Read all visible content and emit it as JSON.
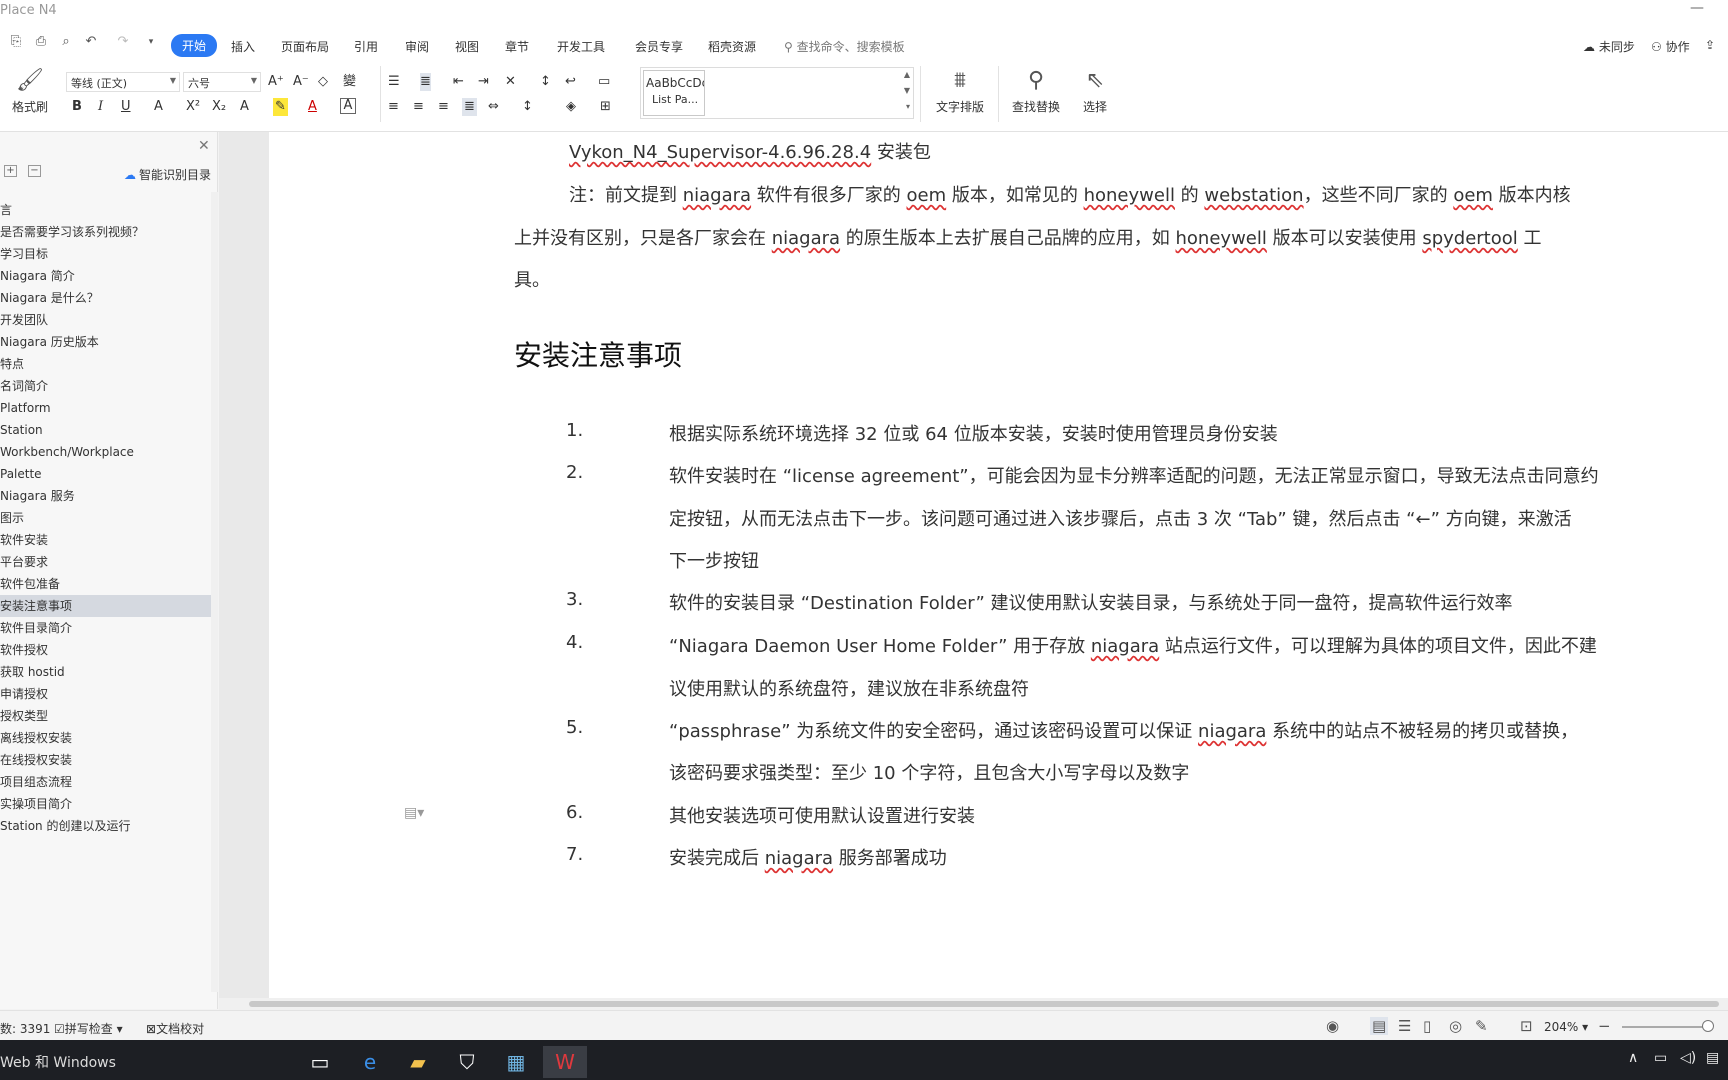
{
  "window": {
    "title": "Place N4"
  },
  "menu": {
    "tabs": [
      "开始",
      "插入",
      "页面布局",
      "引用",
      "审阅",
      "视图",
      "章节",
      "开发工具",
      "会员专享",
      "稻壳资源"
    ],
    "search_placeholder": "查找命令、搜索模板",
    "sync_label": "未同步",
    "collab_label": "协作"
  },
  "ribbon": {
    "format_painter": "格式刷",
    "font_name": "等线 (正文)",
    "font_size": "六号",
    "style_preview": "AaBbCcDc",
    "style_name": "List Pa...",
    "text_layout": "文字排版",
    "find_replace": "查找替换",
    "select": "选择"
  },
  "nav": {
    "smart_toc": "智能识别目录",
    "items": [
      "言",
      "是否需要学习该系列视频？",
      "学习目标",
      " Niagara 简介",
      "Niagara 是什么？",
      "开发团队",
      "Niagara 历史版本",
      "特点",
      " 名词简介",
      "Platform",
      "Station",
      "Workbench/Workplace",
      "Palette",
      "Niagara 服务",
      "图示",
      " 软件安装",
      "平台要求",
      "软件包准备",
      "安装注意事项",
      " 软件目录简介",
      " 软件授权",
      "获取 hostid",
      "申请授权",
      "授权类型",
      "离线授权安装",
      "在线授权安装",
      " 项目组态流程",
      " 实操项目简介",
      " Station 的创建以及运行"
    ],
    "selected_index": 18
  },
  "doc": {
    "line_file_a": "Vykon_N4_Supervisor-4.6.96.28.4",
    "line_file_b": " 安装包",
    "note": {
      "l1": [
        "注：前文提到 ",
        "niagara",
        " 软件有很多厂家的 ",
        "oem",
        " 版本，如常见的 ",
        "honeywell",
        " 的 ",
        "webstation",
        "，这些不同厂家的 ",
        "oem",
        " 版本内核"
      ],
      "l2": [
        "上并没有区别，只是各厂家会在 ",
        "niagara",
        " 的原生版本上去扩展自己品牌的应用，如 ",
        "honeywell",
        " 版本可以安装使用 ",
        "spydertool",
        " 工"
      ],
      "l3": "具。"
    },
    "heading": "安装注意事项",
    "list": {
      "n1": "1.",
      "t1": "根据实际系统环境选择 32 位或 64 位版本安装，安装时使用管理员身份安装",
      "n2": "2.",
      "t2a": "软件安装时在 “license agreement”，可能会因为显卡分辨率适配的问题，无法正常显示窗口，导致无法点击同意约",
      "t2b": "定按钮，从而无法点击下一步。该问题可通过进入该步骤后，点击 3 次 “Tab” 键，然后点击 “←” 方向键，来激活",
      "t2c": "下一步按钮",
      "n3": "3.",
      "t3": "软件的安装目录 “Destination Folder” 建议使用默认安装目录，与系统处于同一盘符，提高软件运行效率",
      "n4": "4.",
      "t4a": [
        "“Niagara Daemon User Home Folder” 用于存放 ",
        "niagara",
        " 站点运行文件，可以理解为具体的项目文件，因此不建"
      ],
      "t4b": "议使用默认的系统盘符，建议放在非系统盘符",
      "n5": "5.",
      "t5a": [
        "“passphrase” 为系统文件的安全密码，通过该密码设置可以保证 ",
        "niagara",
        " 系统中的站点不被轻易的拷贝或替换，"
      ],
      "t5b": "该密码要求强类型：至少 10 个字符，且包含大小写字母以及数字",
      "n6": "6.",
      "t6": "其他安装选项可使用默认设置进行安装",
      "n7": "7.",
      "t7": [
        "安装完成后 ",
        "niagara",
        " 服务部署成功"
      ]
    }
  },
  "statusbar": {
    "word_count": "数: 3391",
    "spell_check": "拼写检查",
    "doc_proof": "文档校对",
    "zoom": "204%"
  },
  "taskbar": {
    "search_text": "Web 和 Windows"
  }
}
